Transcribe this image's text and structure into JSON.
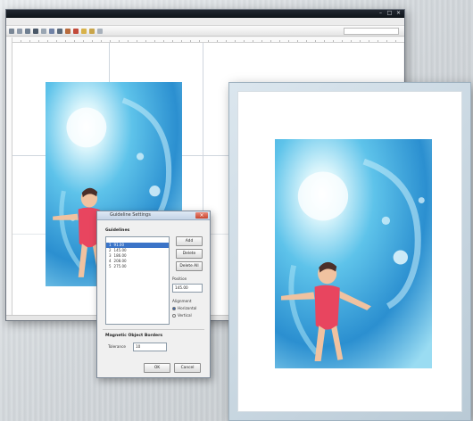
{
  "app": {
    "title": "",
    "menu_items": [],
    "window_controls": [
      "–",
      "□",
      "×"
    ]
  },
  "dialog": {
    "title": "Guideline Settings",
    "section_label": "Guidelines",
    "list_rows": [
      {
        "index": "",
        "value": "",
        "selected": false
      },
      {
        "index": "1",
        "value": "91.00",
        "selected": true
      },
      {
        "index": "2",
        "value": "145.00",
        "selected": false
      },
      {
        "index": "3",
        "value": "186.00",
        "selected": false
      },
      {
        "index": "4",
        "value": "208.00",
        "selected": false
      },
      {
        "index": "5",
        "value": "275.00",
        "selected": false
      }
    ],
    "buttons": {
      "add": "Add",
      "delete": "Delete",
      "delete_all": "Delete All",
      "ok": "OK",
      "cancel": "Cancel"
    },
    "position_label": "Position",
    "position_value": "145.00",
    "alignment_label": "Alignment",
    "radio_horizontal": "Horizontal",
    "radio_vertical": "Vertical",
    "magnetic_label": "Magnetic Object Borders",
    "tolerance_label": "Tolerance",
    "tolerance_value": "10"
  },
  "icons": {
    "toolbar": [
      "select-icon",
      "hand-icon",
      "zoom-icon",
      "line-icon",
      "rect-icon",
      "ellipse-icon",
      "text-icon",
      "crop-icon",
      "rotate-icon",
      "color-icon",
      "layers-icon",
      "grid-icon"
    ]
  },
  "colors": {
    "titlebar": "#1a1f26",
    "selection": "#3b74c8",
    "close_button": "#c8452f",
    "water_light": "#bfe9f7",
    "water_deep": "#2a86c9",
    "swimsuit": "#e8455f"
  }
}
